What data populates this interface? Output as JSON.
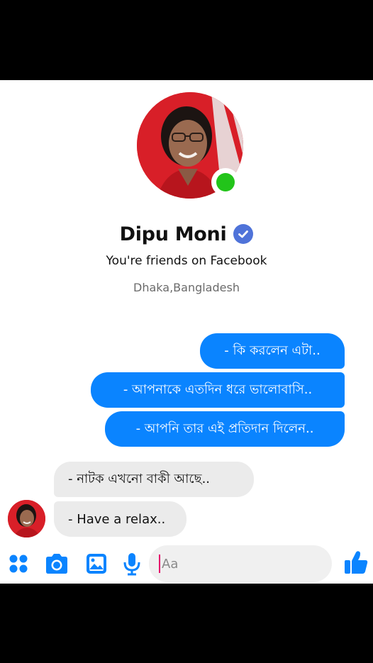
{
  "profile": {
    "name": "Dipu Moni",
    "friends_text": "You're friends on Facebook",
    "location": "Dhaka,Bangladesh",
    "online": true,
    "verified": true
  },
  "messages": {
    "outgoing": [
      "- কি করলেন এটা..",
      "- আপনাকে এতদিন ধরে ভালোবাসি..",
      "- আপনি তার এই প্রতিদান দিলেন.."
    ],
    "incoming": [
      "- নাটক এখনো বাকী আছে..",
      "- Have a relax.."
    ]
  },
  "composer": {
    "placeholder": "Aa",
    "icons": [
      "apps-icon",
      "camera-icon",
      "gallery-icon",
      "microphone-icon",
      "emoji-icon",
      "like-icon"
    ]
  },
  "colors": {
    "outgoing_bubble": "#0a84ff",
    "incoming_bubble": "#ebebeb",
    "accent": "#0a84ff",
    "online": "#22c41a",
    "verified": "#4f73d9"
  }
}
